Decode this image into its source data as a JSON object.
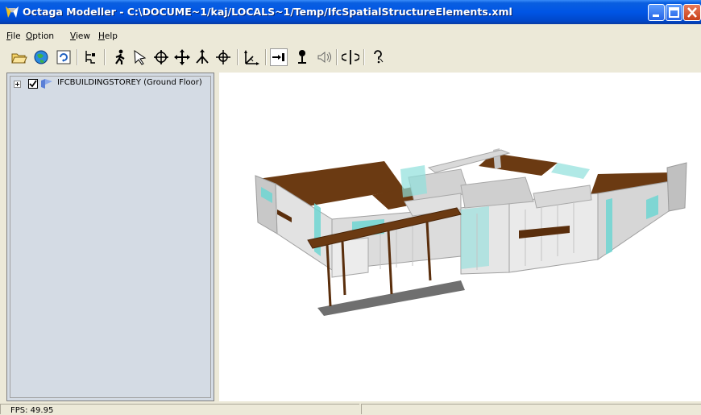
{
  "window": {
    "title": "Octaga Modeller - C:\\DOCUME~1/kaj/LOCALS~1/Temp/IfcSpatialStructureElements.xml",
    "icon": "octaga-app-icon"
  },
  "menu": {
    "items": [
      {
        "mnemonic": "F",
        "rest": "ile"
      },
      {
        "mnemonic": "O",
        "rest": "ption"
      },
      {
        "mnemonic": "V",
        "rest": "iew"
      },
      {
        "mnemonic": "H",
        "rest": "elp"
      }
    ]
  },
  "toolbar": {
    "buttons": [
      "open-icon",
      "globe-icon",
      "refresh-icon",
      "tree-icon",
      "walk-icon",
      "select-arrow-icon",
      "examine-icon",
      "pan-icon",
      "fly-icon",
      "rotate-icon",
      "axes-icon",
      "target-icon",
      "pin-icon",
      "sound-icon",
      "center-icon",
      "help-icon"
    ],
    "pressed": "target-icon"
  },
  "tree": {
    "root_label": "IFCBUILDINGSTOREY (Ground Floor)",
    "checked": true
  },
  "status": {
    "fps": "FPS: 49.95"
  },
  "colors": {
    "titlebar": "#0055e5",
    "panel": "#d4dbe4",
    "chrome": "#ece9d8",
    "wall": "#e8e8e8",
    "floor": "#6b3a12",
    "glass": "#6fd6d2"
  }
}
